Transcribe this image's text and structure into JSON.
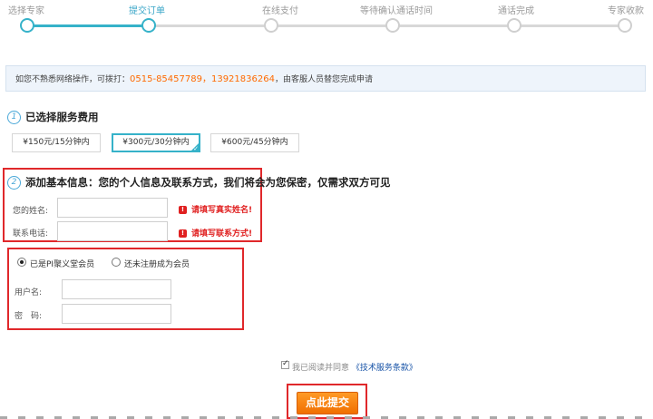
{
  "steps": [
    {
      "label": "选择专家",
      "state": "done"
    },
    {
      "label": "提交订单",
      "state": "active"
    },
    {
      "label": "在线支付",
      "state": "todo"
    },
    {
      "label": "等待确认通话时间",
      "state": "todo"
    },
    {
      "label": "通话完成",
      "state": "todo"
    },
    {
      "label": "专家收款",
      "state": "todo"
    }
  ],
  "notice": {
    "prefix": "如您不熟悉网络操作，可拨打：",
    "phones": "0515-85457789，13921836264",
    "suffix": "，由客服人员替您完成申请"
  },
  "service": {
    "number": "1",
    "title": "已选择服务费用",
    "options": [
      {
        "label": "¥150元/15分钟内",
        "selected": false
      },
      {
        "label": "¥300元/30分钟内",
        "selected": true
      },
      {
        "label": "¥600元/45分钟内",
        "selected": false
      }
    ]
  },
  "basic_info": {
    "number": "2",
    "title": "添加基本信息：您的个人信息及联系方式，我们将会为您保密，仅需求双方可见",
    "name_label": "您的姓名:",
    "name_error": "请填写真实姓名!",
    "phone_label": "联系电话:",
    "phone_error": "请填写联系方式!"
  },
  "member": {
    "option_member": "已是PI聚义堂会员",
    "option_nonmember": "还未注册成为会员",
    "selected": "member",
    "username_label": "用户名:",
    "password_label": "密　码:"
  },
  "agreement": {
    "checked": true,
    "text": "我已阅读并同意",
    "link": "《技术服务条款》"
  },
  "submit_label": "点此提交",
  "colors": {
    "accent": "#36b2c9",
    "error": "#e02020",
    "button": "#ff7a00"
  }
}
